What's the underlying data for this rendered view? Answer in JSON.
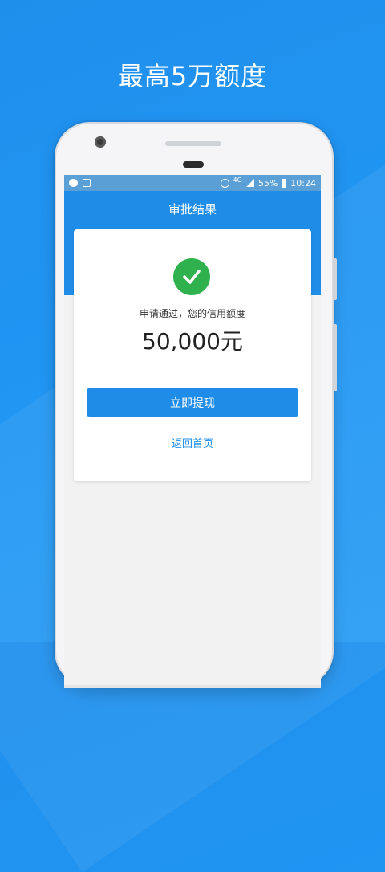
{
  "promo": {
    "headline": "最高5万额度"
  },
  "status_bar": {
    "network": "4G",
    "battery": "55%",
    "time": "10:24"
  },
  "app": {
    "title": "审批结果",
    "result": {
      "message": "申请通过，您的信用额度",
      "amount": "50,000元",
      "primary_button": "立即提现",
      "secondary_link": "返回首页"
    }
  },
  "colors": {
    "primary": "#1f8de8",
    "success": "#2fb14e"
  }
}
